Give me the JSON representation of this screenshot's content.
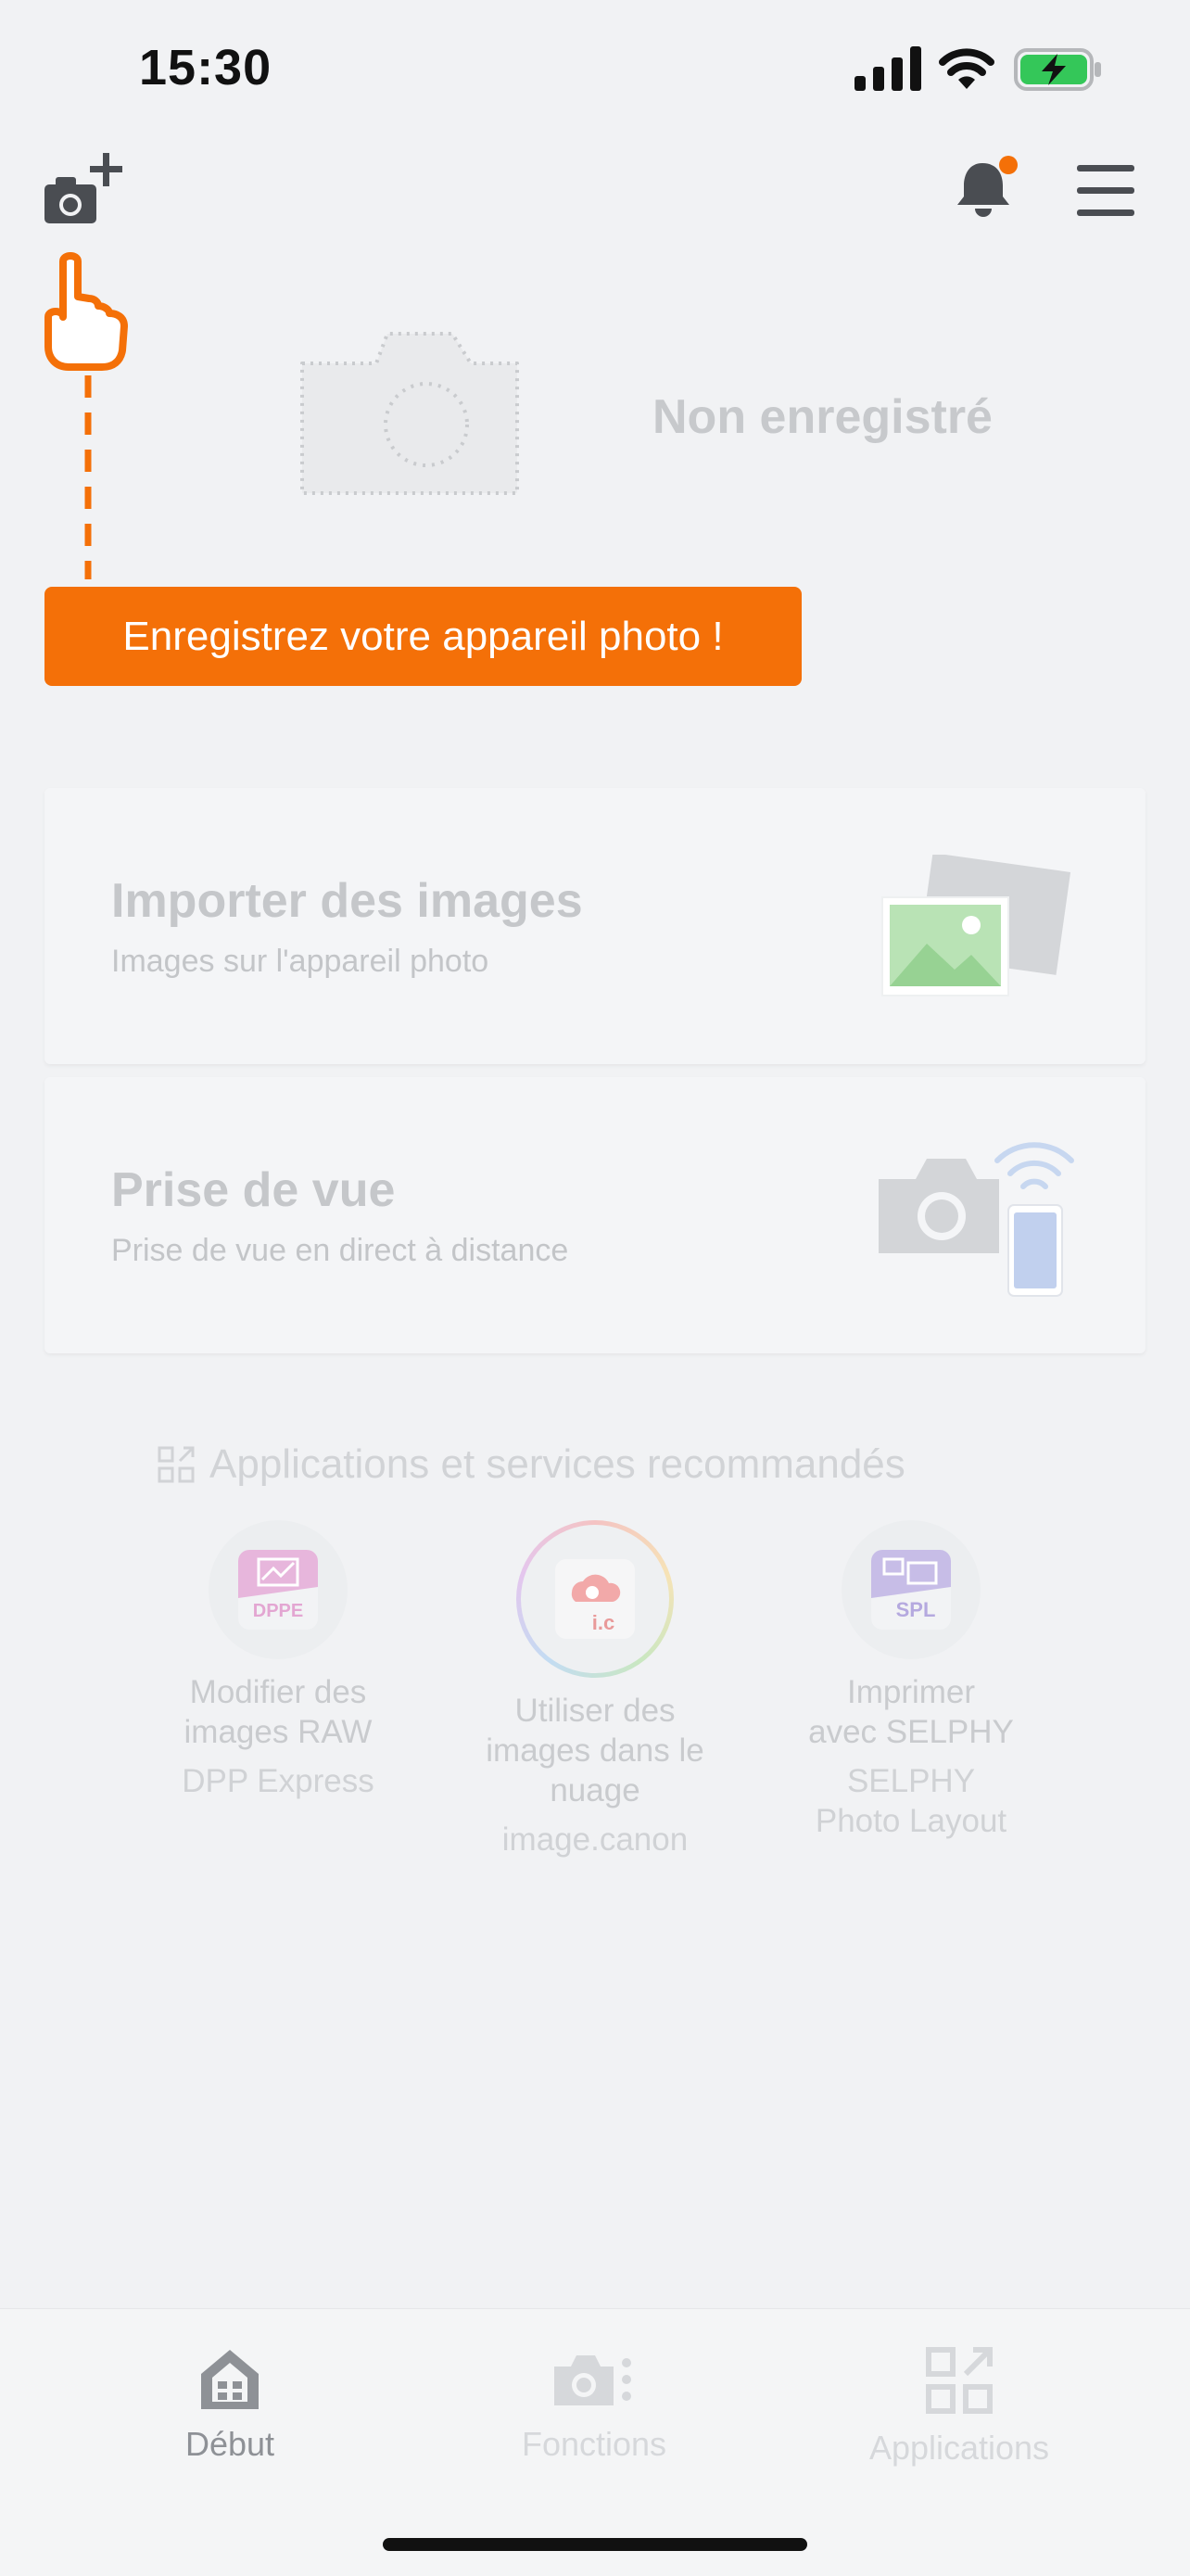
{
  "status_bar": {
    "time": "15:30"
  },
  "header": {
    "add_camera_icon": "camera-plus-icon",
    "notification_icon": "bell-icon",
    "menu_icon": "hamburger-menu-icon"
  },
  "camera_area": {
    "status_text": "Non enregistré"
  },
  "callout": {
    "label": "Enregistrez votre appareil photo !"
  },
  "cards": [
    {
      "title": "Importer des images",
      "subtitle": "Images sur l'appareil photo"
    },
    {
      "title": "Prise de vue",
      "subtitle": "Prise de vue en direct à distance"
    }
  ],
  "recommended": {
    "heading": "Applications et services recommandés",
    "apps": [
      {
        "badge": "DPPE",
        "desc_line1": "Modifier des",
        "desc_line2": "images RAW",
        "desc_line3": "",
        "name_line1": "DPP Express",
        "name_line2": ""
      },
      {
        "badge": "i.c",
        "desc_line1": "Utiliser des",
        "desc_line2": "images dans le",
        "desc_line3": "nuage",
        "name_line1": "image.canon",
        "name_line2": ""
      },
      {
        "badge": "SPL",
        "desc_line1": "Imprimer",
        "desc_line2": "avec SELPHY",
        "desc_line3": "",
        "name_line1": "SELPHY",
        "name_line2": "Photo Layout"
      }
    ]
  },
  "tabs": [
    {
      "label": "Début",
      "icon": "home-icon",
      "active": true
    },
    {
      "label": "Fonctions",
      "icon": "camera-functions-icon",
      "active": false
    },
    {
      "label": "Applications",
      "icon": "apps-grid-icon",
      "active": false
    }
  ],
  "colors": {
    "accent": "#f47008",
    "battery_green": "#34c759",
    "icon_dark": "#4a4d52",
    "tab_active": "#8e9196",
    "tab_inactive": "#d6d8db"
  }
}
